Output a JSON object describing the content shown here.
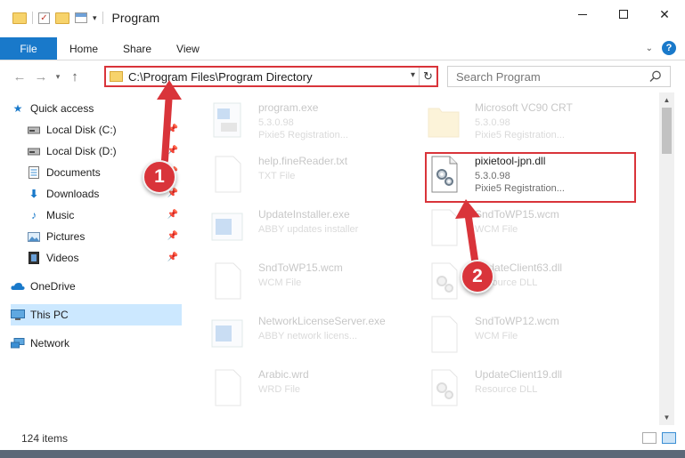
{
  "window": {
    "title": "Program"
  },
  "ribbon": {
    "tabs": [
      "File",
      "Home",
      "Share",
      "View"
    ]
  },
  "address": {
    "path": "C:\\Program Files\\Program Directory"
  },
  "search": {
    "placeholder": "Search Program"
  },
  "sidebar": {
    "items": [
      {
        "label": "Quick access",
        "icon": "star-icon",
        "pinned": false
      },
      {
        "label": "Local Disk (C:)",
        "icon": "drive-icon",
        "pinned": true
      },
      {
        "label": "Local Disk (D:)",
        "icon": "drive-icon",
        "pinned": true
      },
      {
        "label": "Documents",
        "icon": "documents-icon",
        "pinned": true
      },
      {
        "label": "Downloads",
        "icon": "download-icon",
        "pinned": true
      },
      {
        "label": "Music",
        "icon": "music-icon",
        "pinned": true
      },
      {
        "label": "Pictures",
        "icon": "pictures-icon",
        "pinned": true
      },
      {
        "label": "Videos",
        "icon": "videos-icon",
        "pinned": true
      },
      {
        "label": "OneDrive",
        "icon": "cloud-icon",
        "pinned": false
      },
      {
        "label": "This PC",
        "icon": "computer-icon",
        "pinned": false,
        "selected": true
      },
      {
        "label": "Network",
        "icon": "network-icon",
        "pinned": false
      }
    ]
  },
  "files": [
    {
      "name": "program.exe",
      "version": "5.3.0.98",
      "type": "Pixie5 Registration...",
      "icon": "exe-icon"
    },
    {
      "name": "Microsoft VC90 CRT",
      "version": "5.3.0.98",
      "type": "Pixie5 Registration...",
      "icon": "folder-icon"
    },
    {
      "name": "help.fineReader.txt",
      "version": "",
      "type": "TXT File",
      "icon": "text-file-icon"
    },
    {
      "name": "pixietool-jpn.dll",
      "version": "5.3.0.98",
      "type": "Pixie5 Registration...",
      "icon": "dll-gear-icon",
      "highlighted": true
    },
    {
      "name": "UpdateInstaller.exe",
      "version": "",
      "type": "ABBY updates installer",
      "icon": "exe-icon"
    },
    {
      "name": "SndToWP15.wcm",
      "version": "",
      "type": "WCM File",
      "icon": "blank-file-icon"
    },
    {
      "name": "SndToWP15.wcm",
      "version": "",
      "type": "WCM File",
      "icon": "blank-file-icon"
    },
    {
      "name": "UpdateClient63.dll",
      "version": "",
      "type": "Resource DLL",
      "icon": "dll-gear-icon"
    },
    {
      "name": "NetworkLicenseServer.exe",
      "version": "",
      "type": "ABBY network licens...",
      "icon": "exe-icon"
    },
    {
      "name": "SndToWP12.wcm",
      "version": "",
      "type": "WCM File",
      "icon": "blank-file-icon"
    },
    {
      "name": "Arabic.wrd",
      "version": "",
      "type": "WRD File",
      "icon": "blank-file-icon"
    },
    {
      "name": "UpdateClient19.dll",
      "version": "",
      "type": "Resource DLL",
      "icon": "dll-gear-icon"
    }
  ],
  "status": {
    "item_count": "124 items"
  },
  "callouts": [
    "1",
    "2"
  ],
  "colors": {
    "accent": "#1979ca",
    "highlight_red": "#d9343a",
    "selection": "#cce8ff"
  }
}
